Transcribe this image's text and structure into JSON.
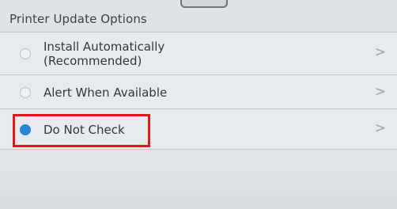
{
  "header": {
    "title": "Printer Update Options"
  },
  "options": [
    {
      "line1": "Install Automatically",
      "line2": "(Recommended)",
      "selected": false
    },
    {
      "line1": "Alert When Available",
      "selected": false
    },
    {
      "line1": "Do Not Check",
      "selected": true
    }
  ],
  "colors": {
    "selected_radio": "#2f83d6",
    "highlight_box": "#e8141b"
  },
  "icons": {
    "chevron": "chevron-right-icon",
    "chevron_glyph": ">"
  }
}
